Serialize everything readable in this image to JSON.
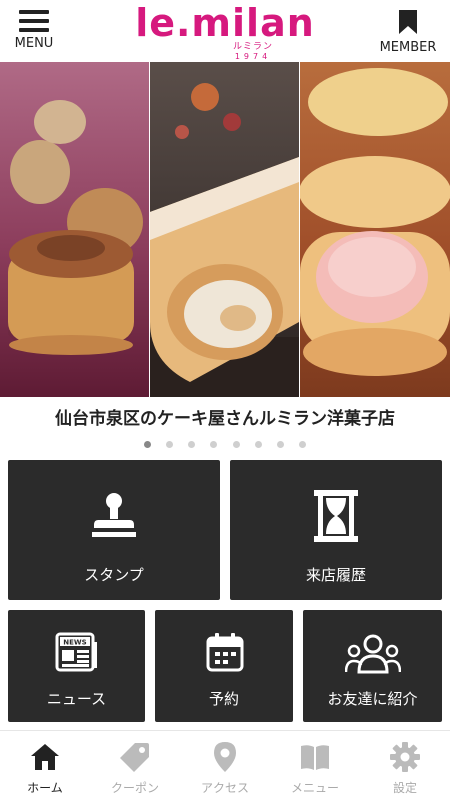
{
  "header": {
    "menu_label": "MENU",
    "member_label": "MEMBER",
    "logo_text": "le.milan",
    "logo_kana": "ルミラン",
    "logo_year": "1974"
  },
  "hero": {
    "tagline": "仙台市泉区のケーキ屋さんルミラン洋菓子店",
    "slide_count": 8,
    "active_slide": 1
  },
  "tiles": {
    "stamp": "スタンプ",
    "history": "来店履歴",
    "news": "ニュース",
    "reserve": "予約",
    "invite": "お友達に紹介",
    "news_badge": "NEWS"
  },
  "bottom_nav": {
    "items": [
      {
        "label": "ホーム",
        "icon": "home-icon",
        "active": true
      },
      {
        "label": "クーポン",
        "icon": "coupon-tag-icon",
        "active": false
      },
      {
        "label": "アクセス",
        "icon": "map-pin-icon",
        "active": false
      },
      {
        "label": "メニュー",
        "icon": "book-icon",
        "active": false
      },
      {
        "label": "設定",
        "icon": "gear-icon",
        "active": false
      }
    ]
  },
  "colors": {
    "brand": "#d6197e",
    "tile_bg": "#2b2b2b",
    "nav_inactive": "#aaaaaa",
    "nav_active": "#222222"
  }
}
